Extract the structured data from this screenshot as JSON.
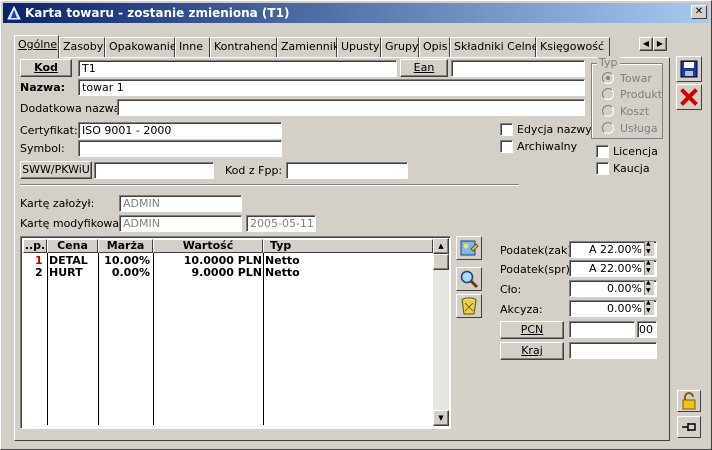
{
  "window": {
    "title": "Karta towaru - zostanie zmieniona (T1)"
  },
  "tabs": [
    {
      "label": "Ogólne"
    },
    {
      "label": "Zasoby"
    },
    {
      "label": "Opakowanie"
    },
    {
      "label": "Inne"
    },
    {
      "label": "Kontrahenci"
    },
    {
      "label": "Zamienniki"
    },
    {
      "label": "Upusty"
    },
    {
      "label": "Grupy"
    },
    {
      "label": "Opis"
    },
    {
      "label": "Składniki Celne"
    },
    {
      "label": "Księgowość"
    }
  ],
  "form": {
    "kod_button": "Kod",
    "kod_value": "T1",
    "ean_button": "Ean",
    "ean_value": "",
    "nazwa_label": "Nazwa:",
    "nazwa_value": "towar 1",
    "dodatkowa_label": "Dodatkowa nazwa:",
    "dodatkowa_value": "",
    "certyfikat_label": "Certyfikat:",
    "certyfikat_value": "ISO 9001 - 2000",
    "symbol_label": "Symbol:",
    "symbol_value": "",
    "sww_button": "SWW/PKWiU",
    "sww_value": "",
    "kod_fpp_label": "Kod z Fpp:",
    "kod_fpp_value": "",
    "edycja_label": "Edycja nazwy",
    "archiwalny_label": "Archiwalny",
    "licencja_label": "Licencja",
    "kaucja_label": "Kaucja",
    "zalozyl_label": "Kartę założył:",
    "zalozyl_value": "ADMIN",
    "modyfikowal_label": "Kartę modyfikował:",
    "modyfikowal_value": "ADMIN",
    "modyfikowal_date": "2005-05-11"
  },
  "typ": {
    "label": "Typ",
    "options": [
      "Towar",
      "Produkt",
      "Koszt",
      "Usługa"
    ],
    "selected": "Towar"
  },
  "grid": {
    "headers": [
      "..p.",
      "Cena",
      "Marża",
      "Wartość",
      "Typ"
    ],
    "rows": [
      {
        "lp": "1",
        "cena": "DETAL",
        "marza": "10.00%",
        "wartosc": "10.0000 PLN",
        "typ": "Netto"
      },
      {
        "lp": "2",
        "cena": "HURT",
        "marza": "0.00%",
        "wartosc": "9.0000 PLN",
        "typ": "Netto"
      }
    ]
  },
  "tax": {
    "podatek_zak_label": "Podatek(zak):",
    "podatek_zak_value": "A 22.00%",
    "podatek_spr_label": "Podatek(spr):",
    "podatek_spr_value": "A 22.00%",
    "clo_label": "Cło:",
    "clo_value": "0.00%",
    "akcyza_label": "Akcyza:",
    "akcyza_value": "0.00%",
    "pcn_button": "PCN",
    "pcn_value": "",
    "pcn_suffix": "00",
    "kraj_button": "Kraj",
    "kraj_value": ""
  },
  "colors": {
    "title_start": "#0a246a",
    "title_end": "#a6caf0",
    "row_lp_red": "#c00000"
  }
}
